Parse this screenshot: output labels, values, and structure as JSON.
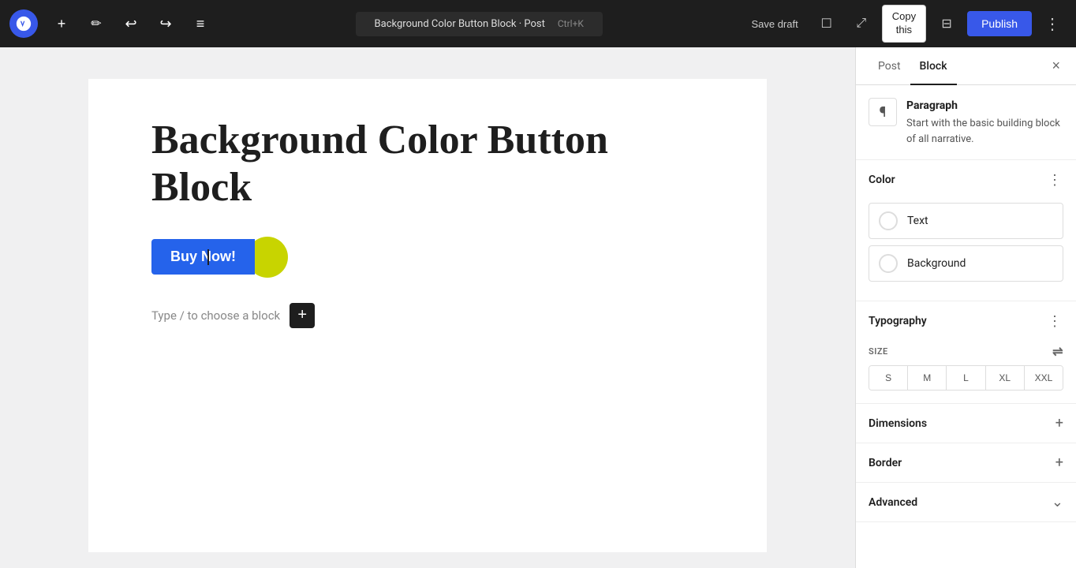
{
  "toolbar": {
    "wp_logo_alt": "WordPress",
    "add_btn": "+",
    "edit_icon": "✏",
    "undo_icon": "↩",
    "redo_icon": "↪",
    "list_view_icon": "≡",
    "post_title": "Background Color Button Block · Post",
    "shortcut": "Ctrl+K",
    "save_draft_label": "Save draft",
    "view_icon": "☐",
    "fullscreen_icon": "⤢",
    "copy_line1": "Copy",
    "copy_line2": "this",
    "settings_icon": "⊟",
    "publish_label": "Publish",
    "more_icon": "⋮"
  },
  "editor": {
    "post_heading": "Background Color Button Block",
    "button_label": "Buy Now!",
    "placeholder_text": "Type / to choose a block",
    "add_block_icon": "+"
  },
  "sidebar": {
    "tab_post": "Post",
    "tab_block": "Block",
    "close_icon": "×",
    "block_icon": "¶",
    "block_title": "Paragraph",
    "block_description": "Start with the basic building block of all narrative.",
    "color_section_title": "Color",
    "color_more_icon": "⋮",
    "text_option_label": "Text",
    "background_option_label": "Background",
    "typography_section_title": "Typography",
    "typography_more_icon": "⋮",
    "size_label": "SIZE",
    "size_controls_icon": "⇌",
    "size_options": [
      "S",
      "M",
      "L",
      "XL",
      "XXL"
    ],
    "dimensions_title": "Dimensions",
    "dimensions_icon": "+",
    "border_title": "Border",
    "border_icon": "+",
    "advanced_title": "Advanced",
    "advanced_icon": "⌄"
  }
}
